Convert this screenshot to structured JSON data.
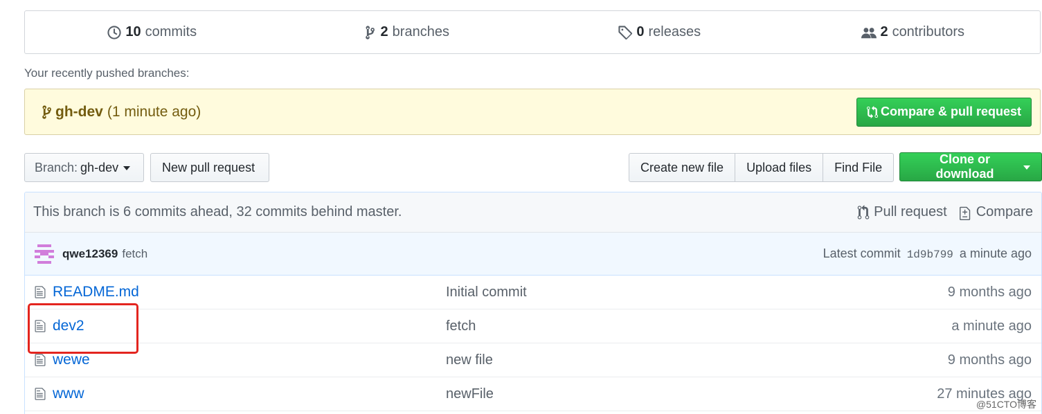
{
  "stats": {
    "commits": {
      "num": "10",
      "label": "commits",
      "icon": "history-icon"
    },
    "branches": {
      "num": "2",
      "label": "branches",
      "icon": "git-branch-icon"
    },
    "releases": {
      "num": "0",
      "label": "releases",
      "icon": "tag-icon"
    },
    "contributors": {
      "num": "2",
      "label": "contributors",
      "icon": "people-icon"
    }
  },
  "recent": {
    "label": "Your recently pushed branches:",
    "branch": "gh-dev",
    "time": "(1 minute ago)",
    "compare_button": "Compare & pull request"
  },
  "toolbar": {
    "branch_label": "Branch:",
    "branch_value": "gh-dev",
    "new_pr": "New pull request",
    "create_file": "Create new file",
    "upload_files": "Upload files",
    "find_file": "Find File",
    "clone": "Clone or download"
  },
  "branch_info": {
    "text": "This branch is 6 commits ahead, 32 commits behind master.",
    "pull_request": "Pull request",
    "compare": "Compare"
  },
  "latest_commit": {
    "author": "qwe12369",
    "message": "fetch",
    "prefix": "Latest commit",
    "sha": "1d9b799",
    "time": "a minute ago"
  },
  "files": [
    {
      "name": "README.md",
      "message": "Initial commit",
      "age": "9 months ago"
    },
    {
      "name": "dev2",
      "message": "fetch",
      "age": "a minute ago"
    },
    {
      "name": "wewe",
      "message": "new file",
      "age": "9 months ago"
    },
    {
      "name": "www",
      "message": "newFile",
      "age": "27 minutes ago"
    }
  ],
  "watermark": "@51CTO博客",
  "colors": {
    "accent_green": "#28a745",
    "link_blue": "#0366d6",
    "highlight_red": "#e3251f",
    "banner_yellow": "#fffbdd"
  }
}
